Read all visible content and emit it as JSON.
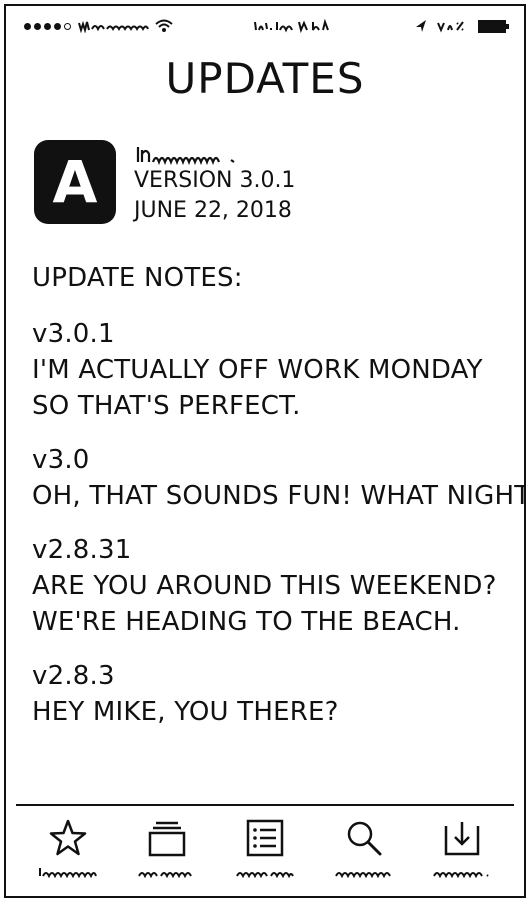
{
  "page": {
    "title": "UPDATES"
  },
  "app": {
    "icon_letter": "A",
    "version": "VERSION 3.0.1",
    "date": "JUNE 22, 2018"
  },
  "notes": {
    "heading": "UPDATE NOTES:",
    "entries": [
      {
        "version": "v3.0.1",
        "lines": [
          "I'M ACTUALLY OFF WORK MONDAY",
          "SO THAT'S PERFECT."
        ]
      },
      {
        "version": "v3.0",
        "lines": [
          "OH, THAT SOUNDS FUN! WHAT NIGHT?"
        ]
      },
      {
        "version": "v2.8.31",
        "lines": [
          "ARE YOU AROUND THIS WEEKEND?",
          "WE'RE HEADING TO THE BEACH."
        ]
      },
      {
        "version": "v2.8.3",
        "lines": [
          "HEY MIKE, YOU THERE?"
        ]
      }
    ]
  },
  "status_bar": {
    "battery_icon": "battery-icon",
    "wifi_icon": "wifi-icon",
    "location_icon": "location-arrow-icon"
  },
  "tab_bar": {
    "tabs": [
      {
        "icon": "star-icon"
      },
      {
        "icon": "stacked-cards-icon"
      },
      {
        "icon": "list-icon"
      },
      {
        "icon": "search-icon"
      },
      {
        "icon": "download-icon"
      }
    ]
  }
}
